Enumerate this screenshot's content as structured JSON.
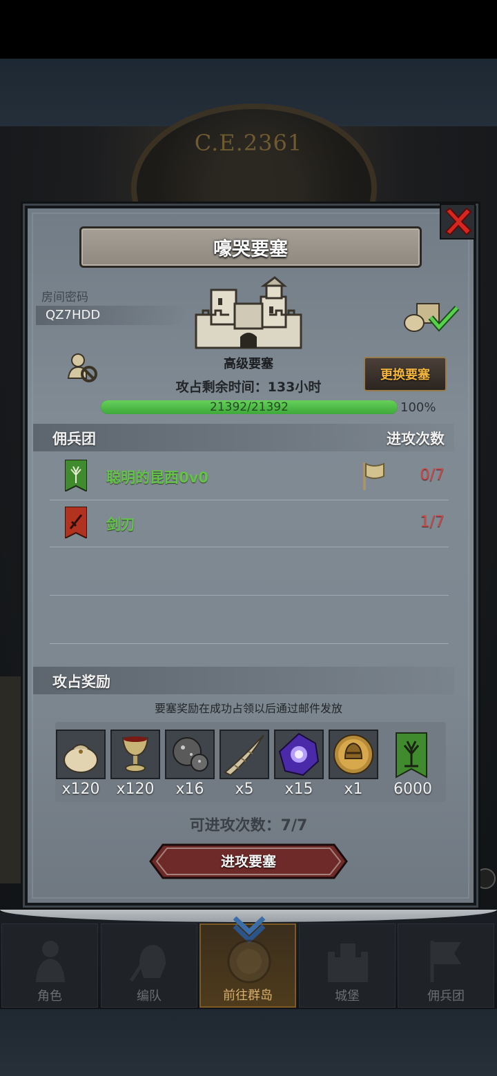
{
  "background": {
    "era_text": "C.E.2361"
  },
  "dialog": {
    "title": "嚎哭要塞",
    "room_label": "房间密码",
    "room_code": "QZ7HDD",
    "fortress_name": "高级要塞",
    "change_button": "更换要塞",
    "time_remaining": "攻占剩余时间：133小时",
    "hp": {
      "text": "21392/21392",
      "percent_text": "100%",
      "fraction": 1.0
    },
    "mercenary_header": "佣兵团",
    "attacks_header": "进攻次数",
    "mercenaries": [
      {
        "name": "聪明的昆西0v0",
        "attacks": "0/7",
        "banner_color": "#3f8b2e",
        "has_flag": true
      },
      {
        "name": "剑刃",
        "attacks": "1/7",
        "banner_color": "#b0321f",
        "has_flag": false
      }
    ],
    "reward_header": "攻占奖励",
    "reward_note": "要塞奖励在成功占领以后通过邮件发放",
    "rewards": [
      {
        "icon": "sack-icon",
        "qty": "x120"
      },
      {
        "icon": "goblet-icon",
        "qty": "x120"
      },
      {
        "icon": "ore-icon",
        "qty": "x16"
      },
      {
        "icon": "horn-icon",
        "qty": "x5"
      },
      {
        "icon": "crystal-icon",
        "qty": "x15"
      },
      {
        "icon": "helmet-coin-icon",
        "qty": "x1"
      },
      {
        "icon": "tree-banner-icon",
        "qty": "6000"
      }
    ],
    "attacks_left": "可进攻次数：7/7",
    "attack_button": "进攻要塞"
  },
  "nav": [
    {
      "label": "角色",
      "icon": "knight-icon"
    },
    {
      "label": "编队",
      "icon": "formation-icon"
    },
    {
      "label": "前往群岛",
      "icon": "compass-icon",
      "active": true
    },
    {
      "label": "城堡",
      "icon": "castle-icon"
    },
    {
      "label": "佣兵团",
      "icon": "mercenary-icon"
    }
  ]
}
